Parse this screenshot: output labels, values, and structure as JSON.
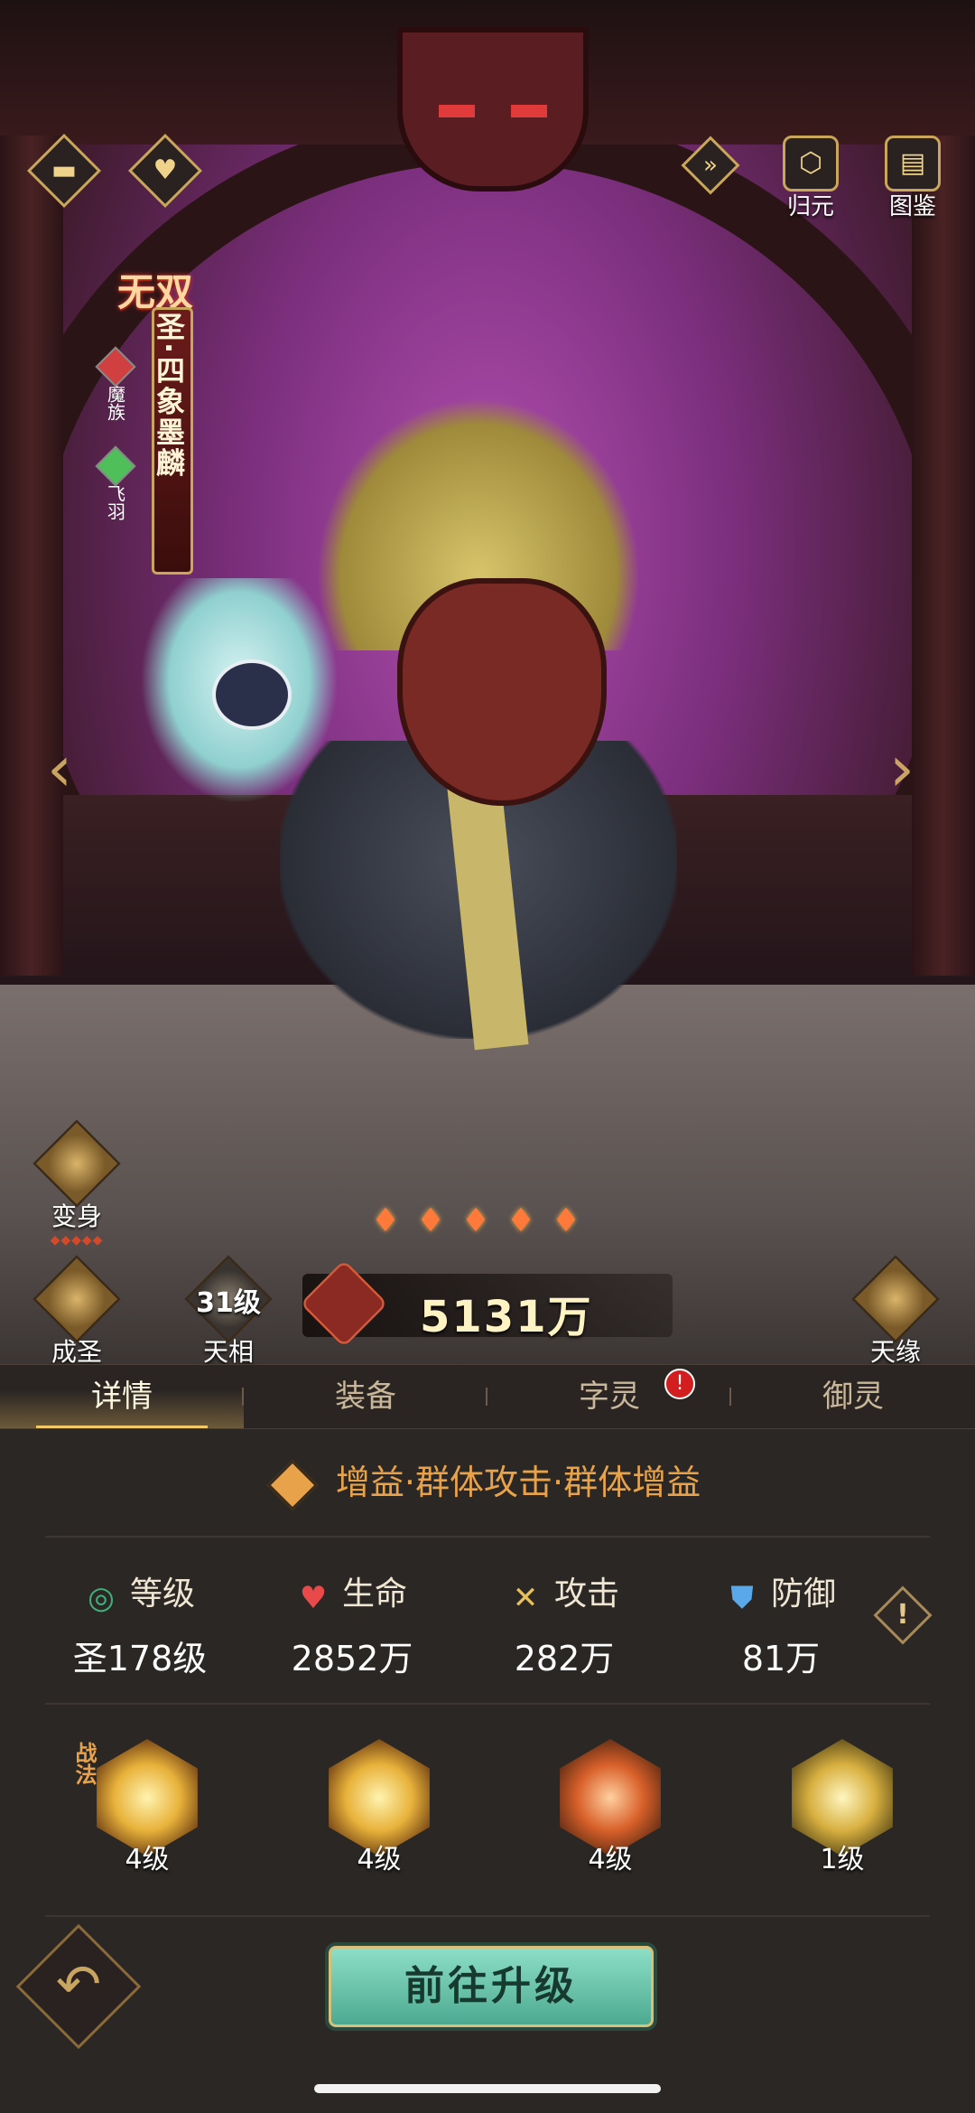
{
  "top_left": {
    "menu_icon": "menu-icon",
    "heart_icon": "heart-icon"
  },
  "top_right": {
    "collapse_icon": "collapse-icon",
    "guiyuan_label": "归元",
    "tujian_label": "图鉴"
  },
  "hero": {
    "badge": "无双",
    "name": "圣·四象墨麟",
    "factions": [
      {
        "label": "魔族",
        "color": "#d04040"
      },
      {
        "label": "飞羽",
        "color": "#4fbf5a"
      }
    ]
  },
  "stars": {
    "count": 5,
    "icon": "flame-star-icon"
  },
  "power": {
    "value": "5131万"
  },
  "side_buttons": {
    "transform_label": "变身",
    "saint_label": "成圣",
    "level_overlay": "31级",
    "tianxiang_label": "天相",
    "tianyuan_label": "天缘"
  },
  "tabs": [
    {
      "label": "详情",
      "active": true
    },
    {
      "label": "装备",
      "active": false
    },
    {
      "label": "字灵",
      "active": false,
      "alert": "!"
    },
    {
      "label": "御灵",
      "active": false
    }
  ],
  "role": {
    "text": "增益·群体攻击·群体增益"
  },
  "stats": [
    {
      "label": "等级",
      "value": "圣178级",
      "icon": "level-icon",
      "color": "#3fb07a"
    },
    {
      "label": "生命",
      "value": "2852万",
      "icon": "heart-icon",
      "color": "#e84a4a"
    },
    {
      "label": "攻击",
      "value": "282万",
      "icon": "swords-icon",
      "color": "#e8c05a"
    },
    {
      "label": "防御",
      "value": "81万",
      "icon": "shield-icon",
      "color": "#5aa8e8"
    }
  ],
  "info_button": {
    "symbol": "!"
  },
  "skills": {
    "zhanfa_tag": "战法",
    "items": [
      {
        "level": "4级"
      },
      {
        "level": "4级"
      },
      {
        "level": "4级"
      },
      {
        "level": "1级"
      }
    ]
  },
  "bottom": {
    "upgrade_label": "前往升级"
  },
  "colors": {
    "accent_gold": "#d9b36a",
    "panel_bg": "#2b2725",
    "role_text": "#e8a34a",
    "upgrade_green": "#6ec8ae"
  }
}
